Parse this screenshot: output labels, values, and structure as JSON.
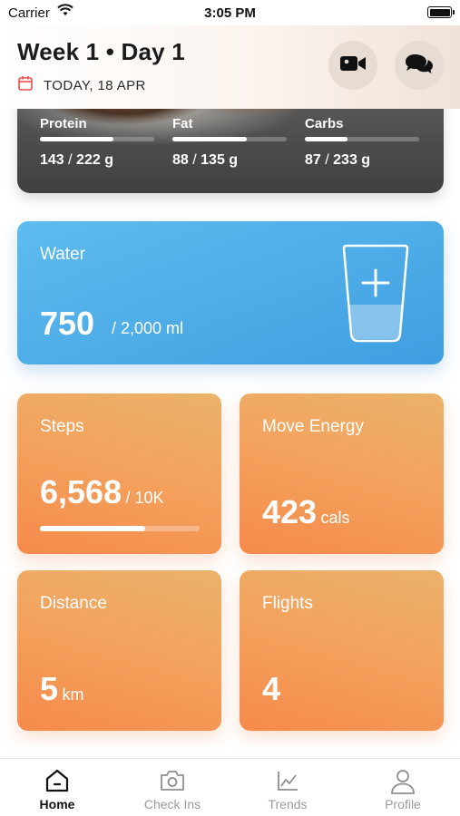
{
  "status_bar": {
    "carrier": "Carrier",
    "time": "3:05 PM"
  },
  "header": {
    "title": "Week 1 • Day 1",
    "date": "TODAY, 18 APR"
  },
  "macros": [
    {
      "label": "Protein",
      "consumed": "143",
      "goal": "222 g",
      "progress": 0.644
    },
    {
      "label": "Fat",
      "consumed": "88",
      "goal": "135 g",
      "progress": 0.652
    },
    {
      "label": "Carbs",
      "consumed": "87",
      "goal": "233 g",
      "progress": 0.373
    }
  ],
  "water": {
    "label": "Water",
    "value": "750",
    "goal": "/ 2,000 ml",
    "accent": "#4aa8e8"
  },
  "steps": {
    "label": "Steps",
    "value": "6,568",
    "goal": "/ 10K",
    "progress": 0.657
  },
  "move_energy": {
    "label": "Move Energy",
    "value": "423",
    "unit": "cals"
  },
  "distance": {
    "label": "Distance",
    "value": "5",
    "unit": "km"
  },
  "flights": {
    "label": "Flights",
    "value": "4"
  },
  "tabs": [
    {
      "label": "Home",
      "icon": "home-icon",
      "active": true
    },
    {
      "label": "Check Ins",
      "icon": "camera-icon",
      "active": false
    },
    {
      "label": "Trends",
      "icon": "chart-icon",
      "active": false
    },
    {
      "label": "Profile",
      "icon": "profile-icon",
      "active": false
    }
  ],
  "colors": {
    "card_orange": "#f68a4b",
    "card_blue": "#4aa8e8",
    "calendar_red": "#e8504f"
  }
}
